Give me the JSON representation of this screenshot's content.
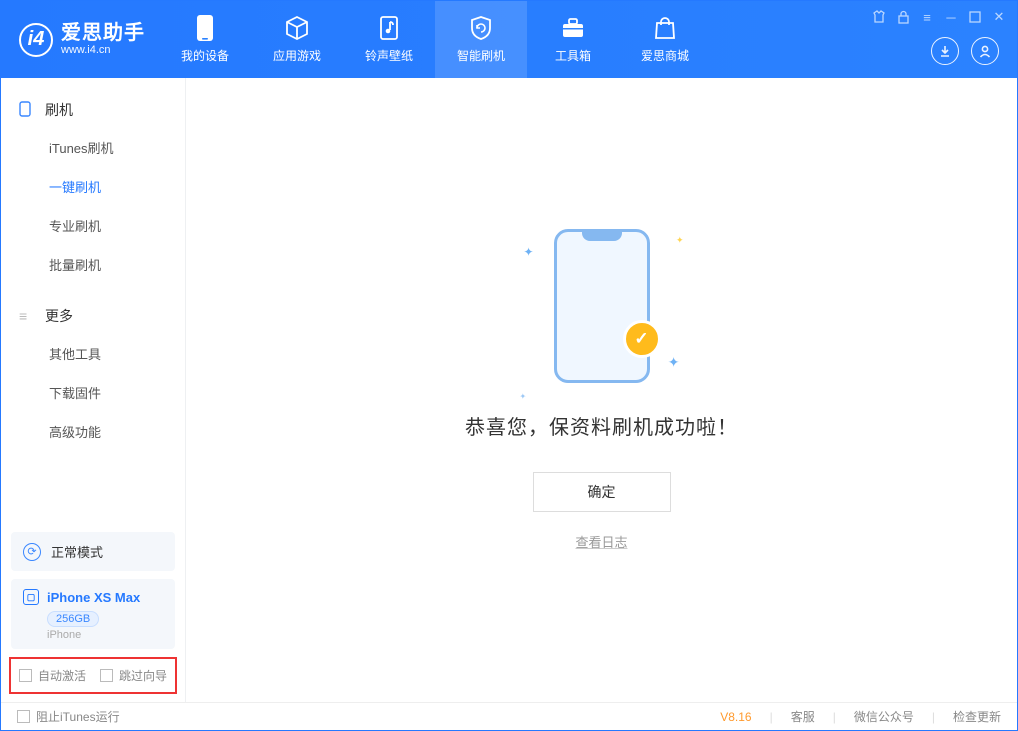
{
  "logo": {
    "title": "爱思助手",
    "sub": "www.i4.cn"
  },
  "tabs": [
    {
      "label": "我的设备"
    },
    {
      "label": "应用游戏"
    },
    {
      "label": "铃声壁纸"
    },
    {
      "label": "智能刷机"
    },
    {
      "label": "工具箱"
    },
    {
      "label": "爱思商城"
    }
  ],
  "sidebar": {
    "flash_head": "刷机",
    "more_head": "更多",
    "items_flash": [
      "iTunes刷机",
      "一键刷机",
      "专业刷机",
      "批量刷机"
    ],
    "items_more": [
      "其他工具",
      "下载固件",
      "高级功能"
    ],
    "active_flash_index": 1
  },
  "mode": {
    "label": "正常模式"
  },
  "device": {
    "name": "iPhone XS Max",
    "capacity": "256GB",
    "type": "iPhone"
  },
  "checks": {
    "auto_activate": "自动激活",
    "skip_guide": "跳过向导"
  },
  "result": {
    "title": "恭喜您，保资料刷机成功啦！",
    "ok": "确定",
    "log": "查看日志"
  },
  "status": {
    "block_itunes": "阻止iTunes运行",
    "version": "V8.16",
    "links": [
      "客服",
      "微信公众号",
      "检查更新"
    ]
  }
}
